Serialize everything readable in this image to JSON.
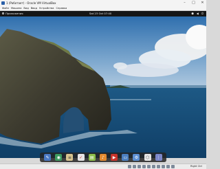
{
  "window": {
    "title": "1 (Работает) - Oracle VM VirtualBox"
  },
  "menubar": {
    "items": [
      "Файл",
      "Машина",
      "Вид",
      "Ввод",
      "Устройства",
      "Справка"
    ]
  },
  "gnome_panel": {
    "activities_label": "Приложения",
    "clock": "Sat 23 Oct  07:40"
  },
  "dock": {
    "apps": [
      {
        "icon": "drawing-app-icon",
        "color": "#4a78c2"
      },
      {
        "icon": "browser-icon",
        "color": "#3c9a5f"
      },
      {
        "icon": "notes-icon",
        "color": "#d7c48f"
      },
      {
        "icon": "tasks-icon",
        "color": "#e5e5e5"
      },
      {
        "icon": "terminal-icon",
        "color": "#8bbd4a"
      },
      {
        "icon": "music-icon",
        "color": "#e28a2f"
      },
      {
        "icon": "video-icon",
        "color": "#c8332b"
      },
      {
        "icon": "files-icon",
        "color": "#4b7fc0"
      },
      {
        "icon": "settings-icon",
        "color": "#5c8fd3"
      },
      {
        "icon": "software-icon",
        "color": "#e6e6e6"
      },
      {
        "icon": "apps-grid-icon",
        "color": "#7a86c8"
      }
    ]
  },
  "statusbar": {
    "host_key": "Right Ctrl"
  }
}
